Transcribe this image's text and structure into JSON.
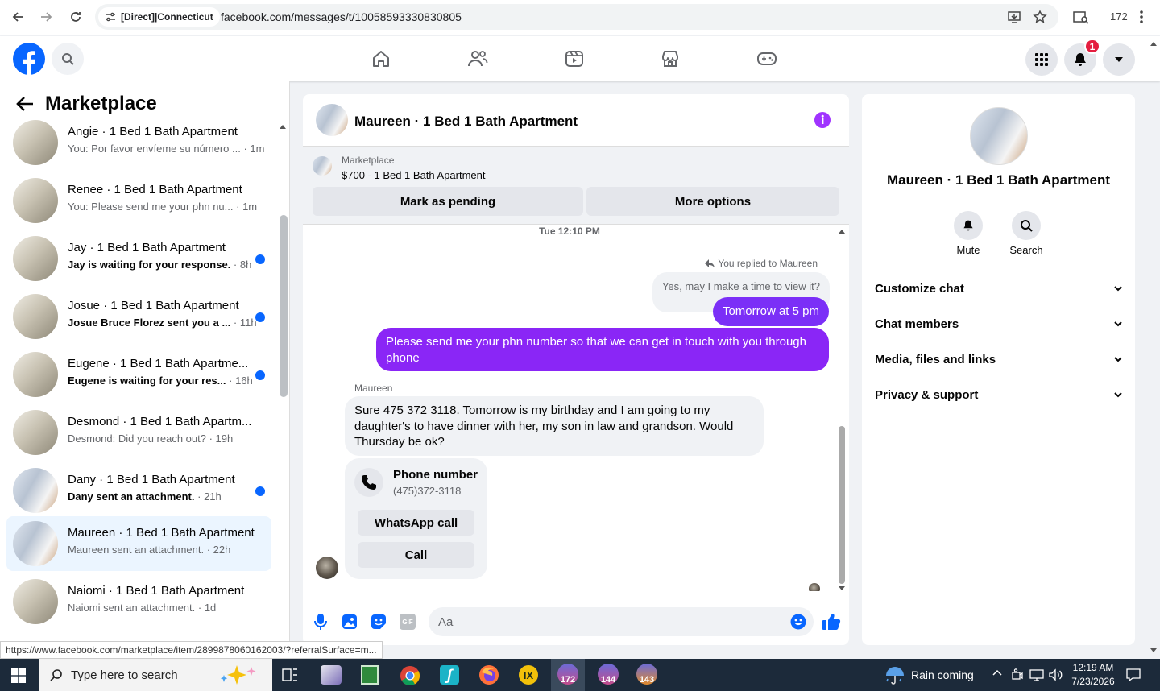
{
  "browser": {
    "site_chip": "[Direct]|Connecticut",
    "url": "facebook.com/messages/t/10058593330830805",
    "tab_count": "172"
  },
  "header": {
    "notification_count": "1"
  },
  "left": {
    "title": "Marketplace",
    "conversations": [
      {
        "title": "Angie · 1 Bed 1 Bath Apartment",
        "preview": "You: Por favor envíeme su número ...",
        "time": "· 1m",
        "unread": false
      },
      {
        "title": "Renee · 1 Bed 1 Bath Apartment",
        "preview": "You: Please send me your phn nu...",
        "time": "· 1m",
        "unread": false
      },
      {
        "title": "Jay · 1 Bed 1 Bath Apartment",
        "preview": "Jay is waiting for your response.",
        "time": "· 8h",
        "unread": true
      },
      {
        "title": "Josue · 1 Bed 1 Bath Apartment",
        "preview": "Josue Bruce Florez sent you a ...",
        "time": "· 11h",
        "unread": true
      },
      {
        "title": "Eugene · 1 Bed 1 Bath Apartme...",
        "preview": "Eugene is waiting for your res...",
        "time": "· 16h",
        "unread": true
      },
      {
        "title": "Desmond · 1 Bed 1 Bath Apartm...",
        "preview": "Desmond: Did you reach out?",
        "time": "· 19h",
        "unread": false
      },
      {
        "title": "Dany · 1 Bed 1 Bath Apartment",
        "preview": "Dany sent an attachment.",
        "time": "· 21h",
        "unread": true
      },
      {
        "title": "Maureen · 1 Bed 1 Bath Apartment",
        "preview": "Maureen sent an attachment.",
        "time": "· 22h",
        "unread": false
      },
      {
        "title": "Naiomi · 1 Bed 1 Bath Apartment",
        "preview": "Naiomi sent an attachment.",
        "time": "· 1d",
        "unread": false
      }
    ]
  },
  "chat": {
    "title": "Maureen · 1 Bed 1 Bath Apartment",
    "listing_source": "Marketplace",
    "listing_title": "$700 - 1 Bed 1 Bath Apartment",
    "mark_pending": "Mark as pending",
    "more_options": "More options",
    "timestamp": "Tue 12:10 PM",
    "replied_to": "You replied to Maureen",
    "quoted_message": "Yes, may I make a time to view it?",
    "msg_out_1": "Tomorrow at 5 pm",
    "msg_out_2": "Please send me your phn number so that we can get in touch with you through phone",
    "sender_name": "Maureen",
    "msg_in_1": "Sure 475 372 3118. Tomorrow is my birthday and I am going to my daughter's to have dinner with her, my son in law and grandson. Would Thursday be ok?",
    "phone_card_title": "Phone number",
    "phone_card_number": "(475)372-3118",
    "whatsapp_call": "WhatsApp call",
    "call": "Call",
    "composer_placeholder": "Aa",
    "gif_label": "GIF"
  },
  "info": {
    "name": "Maureen · 1 Bed 1 Bath Apartment",
    "mute": "Mute",
    "search": "Search",
    "sections": [
      "Customize chat",
      "Chat members",
      "Media, files and links",
      "Privacy & support"
    ]
  },
  "status_bar_url": "https://www.facebook.com/marketplace/item/2899878060162003/?referralSurface=m...",
  "taskbar": {
    "search_placeholder": "Type here to search",
    "weather": "Rain coming",
    "time": "12:19 AM",
    "date": "7/23/2026",
    "badges": [
      "172",
      "144",
      "143"
    ]
  },
  "colors": {
    "fb_blue": "#0866ff",
    "messenger_purple": "#7b2ff7",
    "selected_bg": "#ebf5ff"
  }
}
